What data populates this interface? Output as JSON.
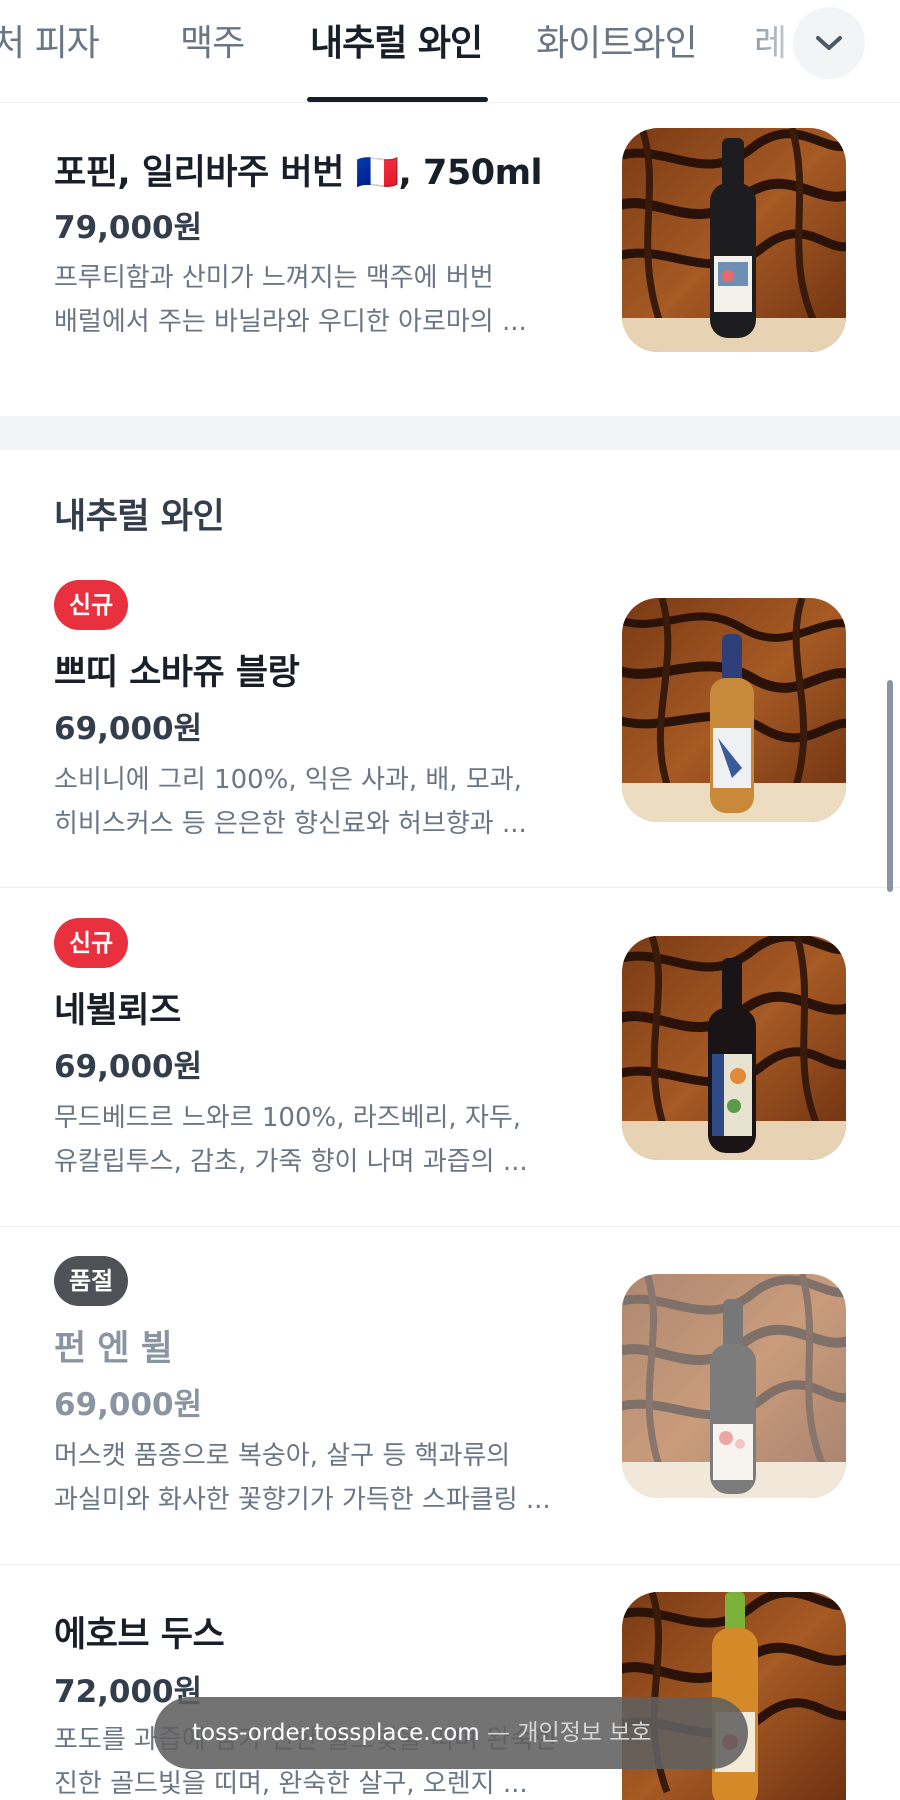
{
  "tabs": [
    {
      "label": "시그니처 피자",
      "shown": "처 피자"
    },
    {
      "label": "맥주",
      "shown": "맥주"
    },
    {
      "label": "내추럴 와인",
      "shown": "내추럴 와인",
      "active": true
    },
    {
      "label": "화이트와인",
      "shown": "화이트와인"
    },
    {
      "label": "레",
      "shown": "레"
    }
  ],
  "expand_icon": "chevron-down-icon",
  "section_title": "내추럴 와인",
  "items": [
    {
      "name": "포핀, 일리바주 버번 🇫🇷, 750ml",
      "price": "79,000원",
      "desc_line1": "프루티함과 산미가 느껴지는 맥주에 버번",
      "desc_line2": "배럴에서 주는 바닐라와 우디한 아로마의 ..."
    },
    {
      "badge": "신규",
      "name": "쁘띠 소바쥬 블랑",
      "price": "69,000원",
      "desc_line1": "소비니에 그리 100%, 익은 사과, 배, 모과,",
      "desc_line2": "히비스커스 등 은은한 향신료와 허브향과 ..."
    },
    {
      "badge": "신규",
      "name": "네뷜뢰즈",
      "price": "69,000원",
      "desc_line1": "무드베드르 느와르 100%, 라즈베리, 자두,",
      "desc_line2": "유칼립투스, 감초, 가죽 향이 나며 과즙의 ..."
    },
    {
      "badge": "품절",
      "name": "펀 엔 뷜",
      "price": "69,000원",
      "desc_line1": "머스캣 품종으로 복숭아, 살구 등 핵과류의",
      "desc_line2": "과실미와 화사한 꽃향기가 가득한 스파클링 ..."
    },
    {
      "name": "에호브 두스",
      "price": "72,000원",
      "desc_line1": "포도를 과즙에 담가 진한 골드빛을 띠며 완숙한 살구",
      "desc_line2": "진한 골드빛을 띠며, 완숙한 살구, 오렌지 ..."
    }
  ],
  "url_toast": {
    "domain": "toss-order.tossplace.com",
    "separator": " — ",
    "label": "개인정보 보호"
  },
  "colors": {
    "badge_new": "#e8303f",
    "badge_soldout": "#4e5256",
    "text_primary": "#191f28",
    "text_secondary": "#6b7684"
  }
}
